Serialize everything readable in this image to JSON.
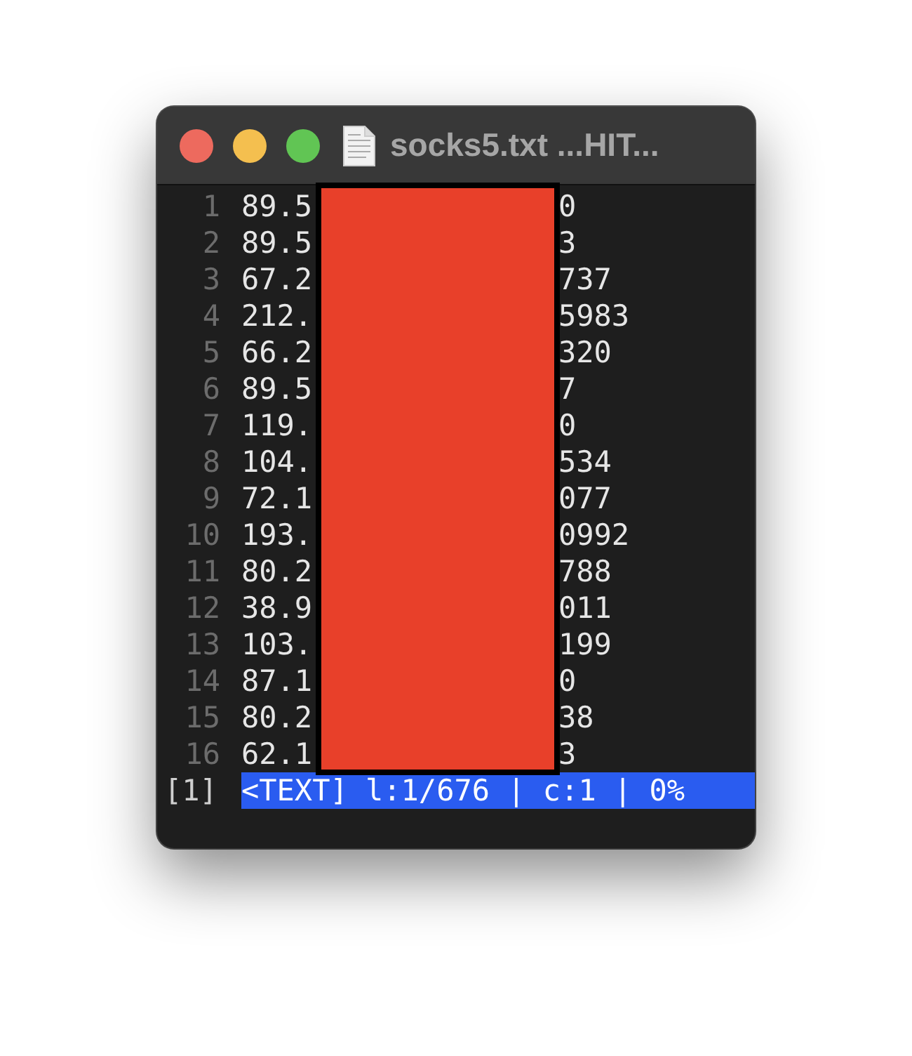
{
  "window": {
    "title": "socks5.txt ...HIT..."
  },
  "lines": [
    {
      "number": "1",
      "start": "89.5",
      "end": "0"
    },
    {
      "number": "2",
      "start": "89.5",
      "end": "3"
    },
    {
      "number": "3",
      "start": "67.2",
      "end": "737"
    },
    {
      "number": "4",
      "start": "212.",
      "end": "5983"
    },
    {
      "number": "5",
      "start": "66.2",
      "end": "320"
    },
    {
      "number": "6",
      "start": "89.5",
      "end": "7"
    },
    {
      "number": "7",
      "start": "119.",
      "end": "0"
    },
    {
      "number": "8",
      "start": "104.",
      "end": "534"
    },
    {
      "number": "9",
      "start": "72.1",
      "end": "077"
    },
    {
      "number": "10",
      "start": "193.",
      "end": "0992"
    },
    {
      "number": "11",
      "start": "80.2",
      "end": "788"
    },
    {
      "number": "12",
      "start": "38.9",
      "end": "011"
    },
    {
      "number": "13",
      "start": "103.",
      "end": "199"
    },
    {
      "number": "14",
      "start": "87.1",
      "end": "0"
    },
    {
      "number": "15",
      "start": "80.2",
      "end": "38"
    },
    {
      "number": "16",
      "start": "62.1",
      "end": "3"
    }
  ],
  "status_bar": {
    "buffer": "[1]",
    "info": "<TEXT] l:1/676 | c:1 | 0%"
  }
}
